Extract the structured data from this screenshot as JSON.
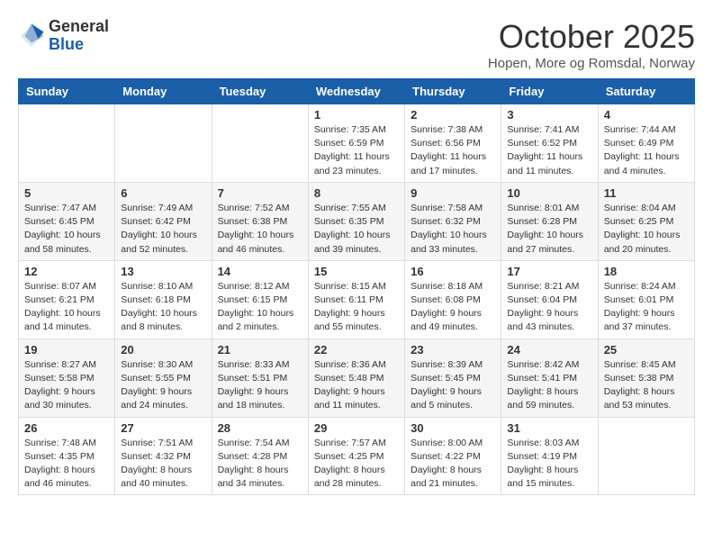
{
  "header": {
    "logo_general": "General",
    "logo_blue": "Blue",
    "month_title": "October 2025",
    "subtitle": "Hopen, More og Romsdal, Norway"
  },
  "weekdays": [
    "Sunday",
    "Monday",
    "Tuesday",
    "Wednesday",
    "Thursday",
    "Friday",
    "Saturday"
  ],
  "weeks": [
    [
      {
        "day": "",
        "info": ""
      },
      {
        "day": "",
        "info": ""
      },
      {
        "day": "",
        "info": ""
      },
      {
        "day": "1",
        "info": "Sunrise: 7:35 AM\nSunset: 6:59 PM\nDaylight: 11 hours\nand 23 minutes."
      },
      {
        "day": "2",
        "info": "Sunrise: 7:38 AM\nSunset: 6:56 PM\nDaylight: 11 hours\nand 17 minutes."
      },
      {
        "day": "3",
        "info": "Sunrise: 7:41 AM\nSunset: 6:52 PM\nDaylight: 11 hours\nand 11 minutes."
      },
      {
        "day": "4",
        "info": "Sunrise: 7:44 AM\nSunset: 6:49 PM\nDaylight: 11 hours\nand 4 minutes."
      }
    ],
    [
      {
        "day": "5",
        "info": "Sunrise: 7:47 AM\nSunset: 6:45 PM\nDaylight: 10 hours\nand 58 minutes."
      },
      {
        "day": "6",
        "info": "Sunrise: 7:49 AM\nSunset: 6:42 PM\nDaylight: 10 hours\nand 52 minutes."
      },
      {
        "day": "7",
        "info": "Sunrise: 7:52 AM\nSunset: 6:38 PM\nDaylight: 10 hours\nand 46 minutes."
      },
      {
        "day": "8",
        "info": "Sunrise: 7:55 AM\nSunset: 6:35 PM\nDaylight: 10 hours\nand 39 minutes."
      },
      {
        "day": "9",
        "info": "Sunrise: 7:58 AM\nSunset: 6:32 PM\nDaylight: 10 hours\nand 33 minutes."
      },
      {
        "day": "10",
        "info": "Sunrise: 8:01 AM\nSunset: 6:28 PM\nDaylight: 10 hours\nand 27 minutes."
      },
      {
        "day": "11",
        "info": "Sunrise: 8:04 AM\nSunset: 6:25 PM\nDaylight: 10 hours\nand 20 minutes."
      }
    ],
    [
      {
        "day": "12",
        "info": "Sunrise: 8:07 AM\nSunset: 6:21 PM\nDaylight: 10 hours\nand 14 minutes."
      },
      {
        "day": "13",
        "info": "Sunrise: 8:10 AM\nSunset: 6:18 PM\nDaylight: 10 hours\nand 8 minutes."
      },
      {
        "day": "14",
        "info": "Sunrise: 8:12 AM\nSunset: 6:15 PM\nDaylight: 10 hours\nand 2 minutes."
      },
      {
        "day": "15",
        "info": "Sunrise: 8:15 AM\nSunset: 6:11 PM\nDaylight: 9 hours\nand 55 minutes."
      },
      {
        "day": "16",
        "info": "Sunrise: 8:18 AM\nSunset: 6:08 PM\nDaylight: 9 hours\nand 49 minutes."
      },
      {
        "day": "17",
        "info": "Sunrise: 8:21 AM\nSunset: 6:04 PM\nDaylight: 9 hours\nand 43 minutes."
      },
      {
        "day": "18",
        "info": "Sunrise: 8:24 AM\nSunset: 6:01 PM\nDaylight: 9 hours\nand 37 minutes."
      }
    ],
    [
      {
        "day": "19",
        "info": "Sunrise: 8:27 AM\nSunset: 5:58 PM\nDaylight: 9 hours\nand 30 minutes."
      },
      {
        "day": "20",
        "info": "Sunrise: 8:30 AM\nSunset: 5:55 PM\nDaylight: 9 hours\nand 24 minutes."
      },
      {
        "day": "21",
        "info": "Sunrise: 8:33 AM\nSunset: 5:51 PM\nDaylight: 9 hours\nand 18 minutes."
      },
      {
        "day": "22",
        "info": "Sunrise: 8:36 AM\nSunset: 5:48 PM\nDaylight: 9 hours\nand 11 minutes."
      },
      {
        "day": "23",
        "info": "Sunrise: 8:39 AM\nSunset: 5:45 PM\nDaylight: 9 hours\nand 5 minutes."
      },
      {
        "day": "24",
        "info": "Sunrise: 8:42 AM\nSunset: 5:41 PM\nDaylight: 8 hours\nand 59 minutes."
      },
      {
        "day": "25",
        "info": "Sunrise: 8:45 AM\nSunset: 5:38 PM\nDaylight: 8 hours\nand 53 minutes."
      }
    ],
    [
      {
        "day": "26",
        "info": "Sunrise: 7:48 AM\nSunset: 4:35 PM\nDaylight: 8 hours\nand 46 minutes."
      },
      {
        "day": "27",
        "info": "Sunrise: 7:51 AM\nSunset: 4:32 PM\nDaylight: 8 hours\nand 40 minutes."
      },
      {
        "day": "28",
        "info": "Sunrise: 7:54 AM\nSunset: 4:28 PM\nDaylight: 8 hours\nand 34 minutes."
      },
      {
        "day": "29",
        "info": "Sunrise: 7:57 AM\nSunset: 4:25 PM\nDaylight: 8 hours\nand 28 minutes."
      },
      {
        "day": "30",
        "info": "Sunrise: 8:00 AM\nSunset: 4:22 PM\nDaylight: 8 hours\nand 21 minutes."
      },
      {
        "day": "31",
        "info": "Sunrise: 8:03 AM\nSunset: 4:19 PM\nDaylight: 8 hours\nand 15 minutes."
      },
      {
        "day": "",
        "info": ""
      }
    ]
  ]
}
